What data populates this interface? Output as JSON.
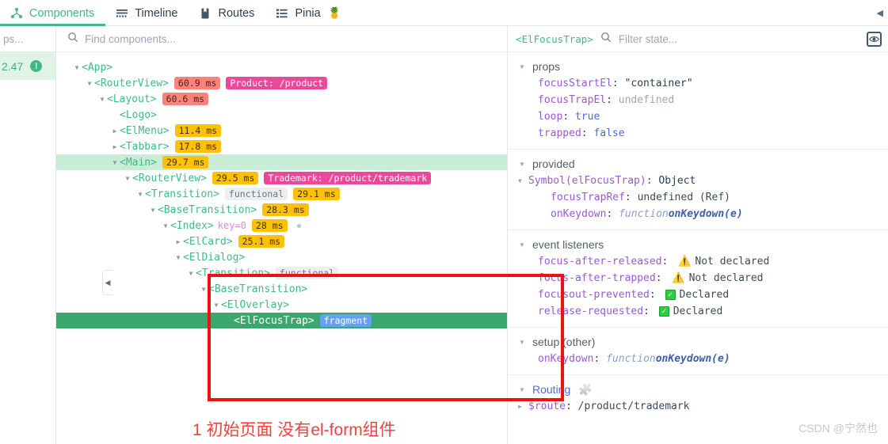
{
  "tabs": [
    {
      "label": "Components",
      "icon": "component-tree-icon",
      "active": true
    },
    {
      "label": "Timeline",
      "icon": "timeline-icon",
      "active": false
    },
    {
      "label": "Routes",
      "icon": "routes-book-icon",
      "active": false
    },
    {
      "label": "Pinia",
      "icon": "pinia-list-icon",
      "emoji": "🍍",
      "active": false
    }
  ],
  "left_column": {
    "search_placeholder": "ps...",
    "version": "2.47"
  },
  "tree_panel": {
    "search_placeholder": "Find components...",
    "nodes": [
      {
        "indent": 0,
        "arrow": "down",
        "tag": "<App>"
      },
      {
        "indent": 1,
        "arrow": "down",
        "tag": "<RouterView>",
        "chips": [
          {
            "text": "60.9 ms",
            "kind": "ms-red"
          },
          {
            "text": "Product: /product",
            "kind": "route"
          }
        ]
      },
      {
        "indent": 2,
        "arrow": "down",
        "tag": "<Layout>",
        "chips": [
          {
            "text": "60.6 ms",
            "kind": "ms-red"
          }
        ]
      },
      {
        "indent": 3,
        "arrow": "none",
        "tag": "<Logo>"
      },
      {
        "indent": 3,
        "arrow": "right",
        "tag": "<ElMenu>",
        "chips": [
          {
            "text": "11.4 ms",
            "kind": "ms-amber"
          }
        ]
      },
      {
        "indent": 3,
        "arrow": "right",
        "tag": "<Tabbar>",
        "chips": [
          {
            "text": "17.8 ms",
            "kind": "ms-amber"
          }
        ]
      },
      {
        "indent": 3,
        "arrow": "down",
        "tag": "<Main>",
        "state": "hovered",
        "chips": [
          {
            "text": "29.7 ms",
            "kind": "ms-amber"
          }
        ]
      },
      {
        "indent": 4,
        "arrow": "down",
        "tag": "<RouterView>",
        "chips": [
          {
            "text": "29.5 ms",
            "kind": "ms-amber"
          },
          {
            "text": "Trademark: /product/trademark",
            "kind": "route"
          }
        ]
      },
      {
        "indent": 5,
        "arrow": "down",
        "tag": "<Transition>",
        "chips": [
          {
            "text": "functional",
            "kind": "flag"
          },
          {
            "text": "29.1 ms",
            "kind": "ms-amber"
          }
        ]
      },
      {
        "indent": 6,
        "arrow": "down",
        "tag": "<BaseTransition>",
        "chips": [
          {
            "text": "28.3 ms",
            "kind": "ms-amber"
          }
        ]
      },
      {
        "indent": 7,
        "arrow": "down",
        "tag": "<Index>",
        "key": "key=0",
        "chips": [
          {
            "text": "28 ms",
            "kind": "ms-amber"
          }
        ],
        "dot": true
      },
      {
        "indent": 8,
        "arrow": "right",
        "tag": "<ElCard>",
        "chips": [
          {
            "text": "25.1 ms",
            "kind": "ms-amber"
          }
        ]
      },
      {
        "indent": 8,
        "arrow": "down",
        "tag": "<ElDialog>"
      },
      {
        "indent": 9,
        "arrow": "down",
        "tag": "<Transition>",
        "chips": [
          {
            "text": "functional",
            "kind": "flag"
          }
        ]
      },
      {
        "indent": 10,
        "arrow": "down",
        "tag": "<BaseTransition>"
      },
      {
        "indent": 11,
        "arrow": "down",
        "tag": "<ElOverlay>"
      },
      {
        "indent": 12,
        "arrow": "none",
        "tag": "<ElFocusTrap>",
        "state": "selected",
        "chips": [
          {
            "text": "fragment",
            "kind": "fragment"
          }
        ]
      }
    ],
    "annotation": "1 初始页面 没有el-form组件"
  },
  "inspector": {
    "component_name": "<ElFocusTrap>",
    "filter_placeholder": "Filter state...",
    "sections": [
      {
        "title": "props",
        "rows": [
          {
            "key": "focusStartEl",
            "value": "\"container\"",
            "value_kind": "str"
          },
          {
            "key": "focusTrapEl",
            "value": "undefined",
            "value_kind": "undef"
          },
          {
            "key": "loop",
            "value": "true",
            "value_kind": "bool"
          },
          {
            "key": "trapped",
            "value": "false",
            "value_kind": "bool"
          }
        ]
      },
      {
        "title": "provided",
        "rows": [
          {
            "key": "Symbol(elFocusTrap)",
            "value": "Object",
            "value_kind": "obj",
            "tri": "down",
            "level": 1
          },
          {
            "key": "focusTrapRef",
            "value": "undefined (Ref)",
            "value_kind": "plain",
            "level": 2
          },
          {
            "key": "onKeydown",
            "value": "function onKeydown(e)",
            "value_kind": "fn",
            "level": 2
          }
        ]
      },
      {
        "title": "event listeners",
        "rows": [
          {
            "key": "focus-after-released",
            "value": "Not declared",
            "value_kind": "warn"
          },
          {
            "key": "focus-after-trapped",
            "value": "Not declared",
            "value_kind": "warn"
          },
          {
            "key": "focusout-prevented",
            "value": "Declared",
            "value_kind": "ok"
          },
          {
            "key": "release-requested",
            "value": "Declared",
            "value_kind": "ok"
          }
        ]
      },
      {
        "title": "setup (other)",
        "rows": [
          {
            "key": "onKeydown",
            "value": "function onKeydown(e)",
            "value_kind": "fn"
          }
        ]
      },
      {
        "title": "Routing",
        "accent": true,
        "icon": "puzzle-icon",
        "rows": [
          {
            "key": "$route",
            "value": "/product/trademark",
            "value_kind": "path",
            "tri": "right",
            "level": 1
          }
        ]
      }
    ],
    "eye_icon": "eye-inspect-icon"
  },
  "watermark": "CSDN @宁然也",
  "colors": {
    "vue_green": "#42b883",
    "selected_row": "#3aa86e",
    "hover_row": "#c8ecd6",
    "annotation_red": "#ee1111",
    "route_chip": "#ec4899",
    "ms_red": "#fb8278",
    "ms_amber": "#ffc107",
    "fragment_blue": "#63a2f1"
  }
}
